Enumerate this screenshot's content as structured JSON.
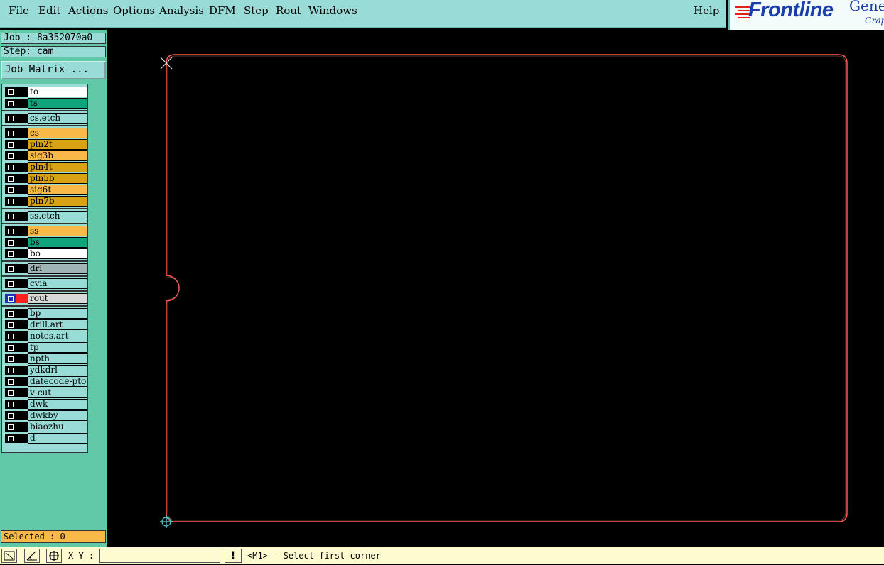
{
  "menu": {
    "file": "File",
    "edit": "Edit",
    "actions": "Actions",
    "options": "Options",
    "analysis": "Analysis",
    "dfm": "DFM",
    "step": "Step",
    "rout": "Rout",
    "windows": "Windows",
    "help": "Help"
  },
  "logo": {
    "brand": "Frontline",
    "product": "Gene",
    "subtitle": "Grap"
  },
  "job": {
    "job_line": "Job : 8a352070a0",
    "step_line": "Step: cam",
    "matrix_button": "Job Matrix ..."
  },
  "layers": [
    {
      "name": "to",
      "color": "#ffffff"
    },
    {
      "name": "ts",
      "color": "#10a47c"
    },
    {
      "name": "cs.etch",
      "color": "#99dbd7"
    },
    {
      "name": "cs",
      "color": "#f8b948"
    },
    {
      "name": "pln2t",
      "color": "#d9a214"
    },
    {
      "name": "sig3b",
      "color": "#f8b948"
    },
    {
      "name": "pln4t",
      "color": "#d9a214"
    },
    {
      "name": "pln5b",
      "color": "#d9a214"
    },
    {
      "name": "sig6t",
      "color": "#f8b948"
    },
    {
      "name": "pln7b",
      "color": "#d9a214"
    },
    {
      "name": "ss.etch",
      "color": "#99dbd7"
    },
    {
      "name": "ss",
      "color": "#f8b948"
    },
    {
      "name": "bs",
      "color": "#10a47c"
    },
    {
      "name": "bo",
      "color": "#ffffff"
    },
    {
      "name": "drl",
      "color": "#9fb4b4"
    },
    {
      "name": "cvia",
      "color": "#99dbd7"
    },
    {
      "name": "rout",
      "color": "#d8d8d8"
    },
    {
      "name": "bp",
      "color": "#99dbd7"
    },
    {
      "name": "drill.art",
      "color": "#99dbd7"
    },
    {
      "name": "notes.art",
      "color": "#99dbd7"
    },
    {
      "name": "tp",
      "color": "#99dbd7"
    },
    {
      "name": "npth",
      "color": "#99dbd7"
    },
    {
      "name": "ydkdrl",
      "color": "#99dbd7"
    },
    {
      "name": "datecode-pto",
      "color": "#99dbd7"
    },
    {
      "name": "v-cut",
      "color": "#99dbd7"
    },
    {
      "name": "dwk",
      "color": "#99dbd7"
    },
    {
      "name": "dwkby",
      "color": "#99dbd7"
    },
    {
      "name": "biaozhu",
      "color": "#99dbd7"
    },
    {
      "name": "d",
      "color": "#99dbd7"
    }
  ],
  "selected": "Selected : 0",
  "bottom": {
    "xy_label": "X Y :",
    "xy_value": "",
    "warn": "!",
    "status": "<M1> - Select first corner"
  },
  "colors": {
    "profile": "#ff5a4a",
    "marker": "#dcdcdc",
    "origin": "#4fd0e0",
    "active_layer": "#ff2020"
  }
}
